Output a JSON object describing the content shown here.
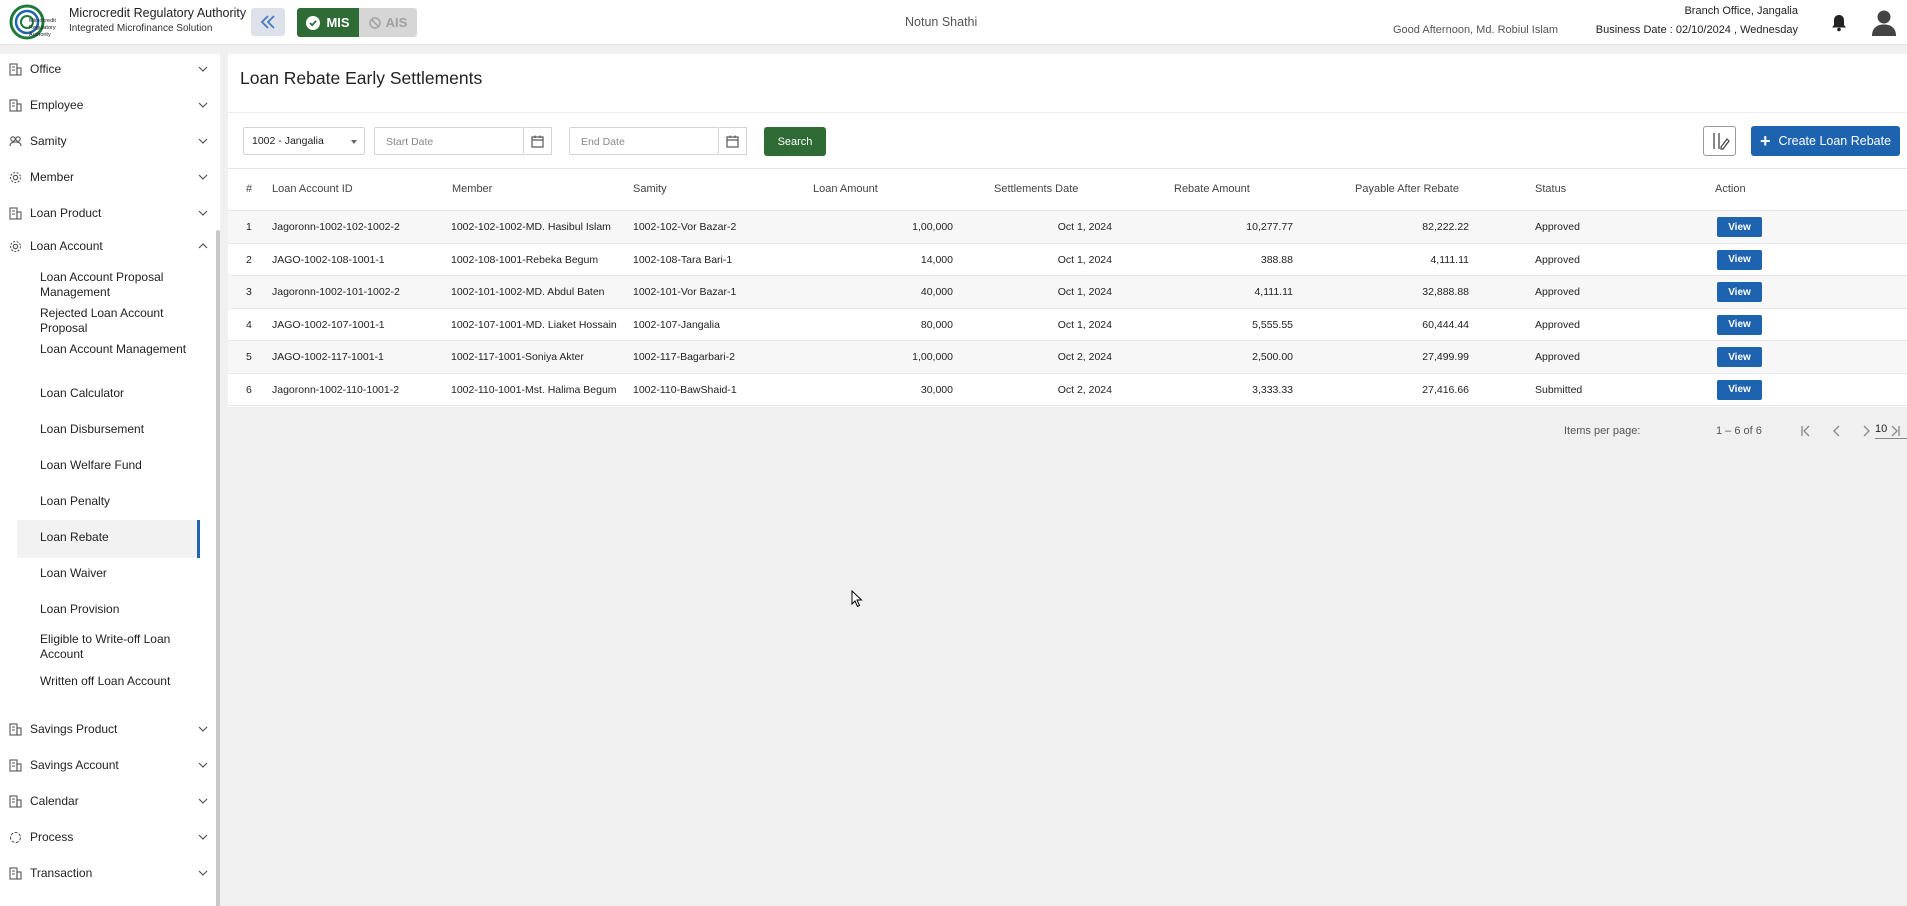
{
  "header": {
    "org_name": "Microcredit Regulatory Authority",
    "org_sub": "Integrated Microfinance Solution",
    "logo_text": "Microcredit Regulatory Authority",
    "mode_mis": "MIS",
    "mode_ais": "AIS",
    "center_title": "Notun Shathi",
    "greeting": "Good Afternoon, Md. Robiul Islam",
    "branch": "Branch Office, Jangalia",
    "business_date": "Business Date : 02/10/2024 , Wednesday"
  },
  "sidebar": {
    "items": [
      {
        "label": "Office",
        "icon": "building-icon"
      },
      {
        "label": "Employee",
        "icon": "building-icon"
      },
      {
        "label": "Samity",
        "icon": "group-icon"
      },
      {
        "label": "Member",
        "icon": "gear-icon"
      },
      {
        "label": "Loan Product",
        "icon": "building-icon"
      },
      {
        "label": "Loan Account",
        "icon": "gear-icon"
      }
    ],
    "loan_account_sub": [
      "Loan Account Proposal Management",
      "Rejected Loan Account Proposal",
      "Loan Account Management",
      "Loan Calculator",
      "Loan Disbursement",
      "Loan Welfare Fund",
      "Loan Penalty",
      "Loan Rebate",
      "Loan Waiver",
      "Loan Provision",
      "Eligible to Write-off Loan Account",
      "Written off Loan Account"
    ],
    "bottom_items": [
      {
        "label": "Savings Product",
        "icon": "building-icon"
      },
      {
        "label": "Savings Account",
        "icon": "building-icon"
      },
      {
        "label": "Calendar",
        "icon": "building-icon"
      },
      {
        "label": "Process",
        "icon": "cycle-icon"
      },
      {
        "label": "Transaction",
        "icon": "building-icon"
      }
    ]
  },
  "main": {
    "title": "Loan Rebate Early Settlements",
    "branch_select": "1002 - Jangalia",
    "start_date_placeholder": "Start Date",
    "end_date_placeholder": "End Date",
    "search_label": "Search",
    "create_label": "Create Loan Rebate",
    "columns": [
      "#",
      "Loan Account ID",
      "Member",
      "Samity",
      "Loan Amount",
      "Settlements Date",
      "Rebate Amount",
      "Payable After Rebate",
      "Status",
      "Action"
    ],
    "rows": [
      {
        "no": "1",
        "account": "Jagoronn-1002-102-1002-2",
        "member": "1002-102-1002-MD. Hasibul Islam",
        "samity": "1002-102-Vor Bazar-2",
        "loan": "1,00,000",
        "date": "Oct 1, 2024",
        "rebate": "10,277.77",
        "payable": "82,222.22",
        "status": "Approved",
        "action": "View"
      },
      {
        "no": "2",
        "account": "JAGO-1002-108-1001-1",
        "member": "1002-108-1001-Rebeka Begum",
        "samity": "1002-108-Tara Bari-1",
        "loan": "14,000",
        "date": "Oct 1, 2024",
        "rebate": "388.88",
        "payable": "4,111.11",
        "status": "Approved",
        "action": "View"
      },
      {
        "no": "3",
        "account": "Jagoronn-1002-101-1002-2",
        "member": "1002-101-1002-MD. Abdul Baten",
        "samity": "1002-101-Vor Bazar-1",
        "loan": "40,000",
        "date": "Oct 1, 2024",
        "rebate": "4,111.11",
        "payable": "32,888.88",
        "status": "Approved",
        "action": "View"
      },
      {
        "no": "4",
        "account": "JAGO-1002-107-1001-1",
        "member": "1002-107-1001-MD. Liaket Hossain",
        "samity": "1002-107-Jangalia",
        "loan": "80,000",
        "date": "Oct 1, 2024",
        "rebate": "5,555.55",
        "payable": "60,444.44",
        "status": "Approved",
        "action": "View"
      },
      {
        "no": "5",
        "account": "JAGO-1002-117-1001-1",
        "member": "1002-117-1001-Soniya Akter",
        "samity": "1002-117-Bagarbari-2",
        "loan": "1,00,000",
        "date": "Oct 2, 2024",
        "rebate": "2,500.00",
        "payable": "27,499.99",
        "status": "Approved",
        "action": "View"
      },
      {
        "no": "6",
        "account": "Jagoronn-1002-110-1001-2",
        "member": "1002-110-1001-Mst. Halima Begum",
        "samity": "1002-110-BawShaid-1",
        "loan": "30,000",
        "date": "Oct 2, 2024",
        "rebate": "3,333.33",
        "payable": "27,416.66",
        "status": "Submitted",
        "action": "View"
      }
    ],
    "paginator": {
      "items_per_page_label": "Items per page:",
      "items_per_page": "10",
      "range": "1 – 6 of 6"
    }
  },
  "colors": {
    "green": "#2e6b35",
    "blue": "#1e63b0"
  }
}
